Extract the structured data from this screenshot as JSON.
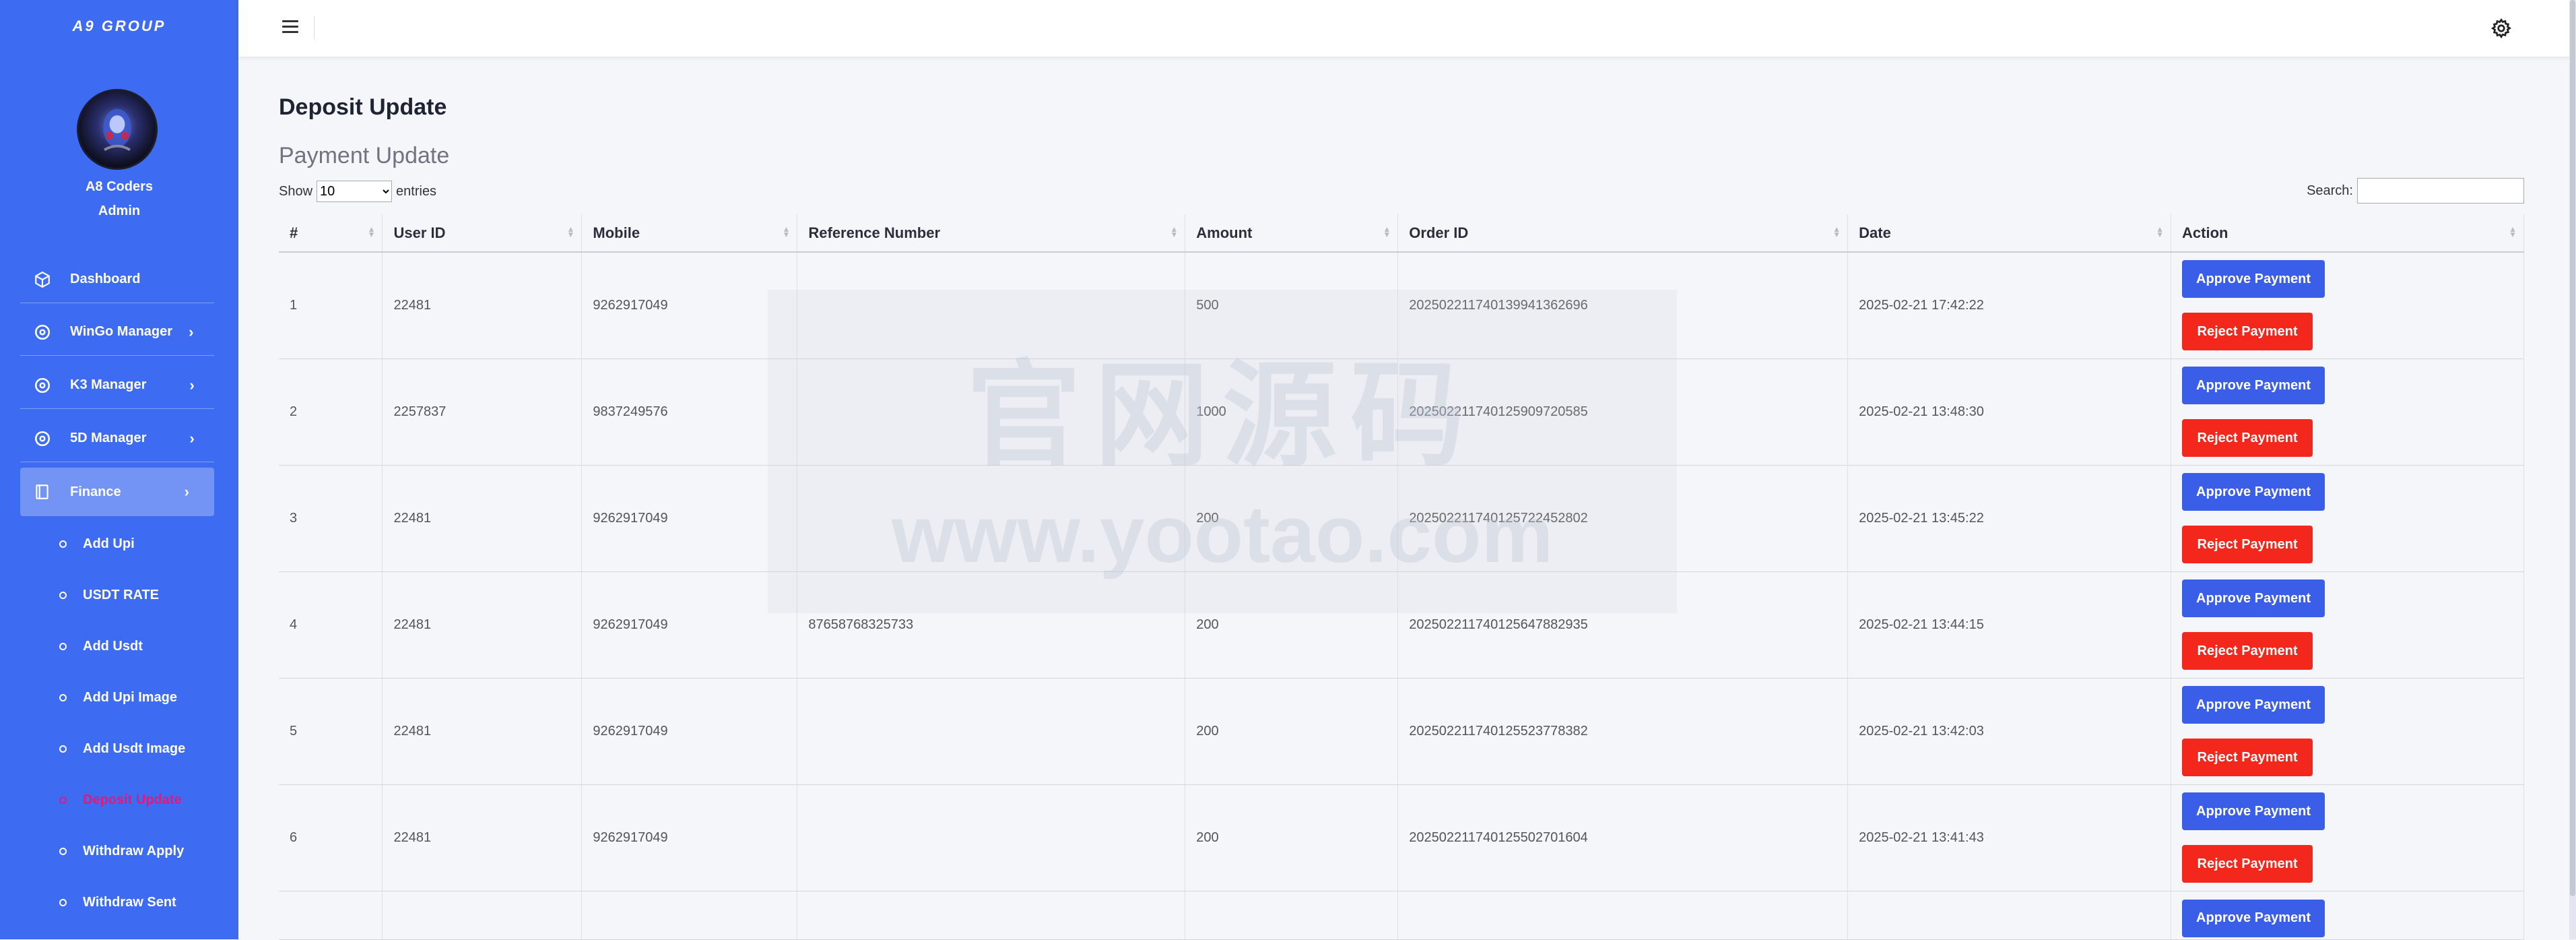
{
  "sidebar": {
    "brand": "A9 GROUP",
    "user_name": "A8 Coders",
    "user_role": "Admin",
    "nav": [
      {
        "label": "Dashboard",
        "icon": "cube-icon"
      },
      {
        "label": "WinGo Manager",
        "icon": "target-icon"
      },
      {
        "label": "K3 Manager",
        "icon": "target-icon"
      },
      {
        "label": "5D Manager",
        "icon": "target-icon"
      },
      {
        "label": "Finance",
        "icon": "book-icon"
      }
    ],
    "sub": [
      {
        "label": "Add Upi"
      },
      {
        "label": "USDT RATE"
      },
      {
        "label": "Add Usdt"
      },
      {
        "label": "Add Upi Image"
      },
      {
        "label": "Add Usdt Image"
      },
      {
        "label": "Deposit Update"
      },
      {
        "label": "Withdraw Apply"
      },
      {
        "label": "Withdraw Sent"
      }
    ]
  },
  "page": {
    "title": "Deposit Update",
    "section": "Payment Update",
    "show_prefix": "Show",
    "show_value": "10",
    "show_suffix": "entries",
    "search_label": "Search:"
  },
  "table": {
    "headers": [
      "#",
      "User ID",
      "Mobile",
      "Reference Number",
      "Amount",
      "Order ID",
      "Date",
      "Action"
    ],
    "approve_label": "Approve Payment",
    "reject_label": "Reject Payment",
    "rows": [
      {
        "n": "1",
        "user": "22481",
        "mobile": "9262917049",
        "ref": "",
        "amount": "500",
        "order": "20250221174013994136269​6",
        "date": "2025-02-21 17:42:22"
      },
      {
        "n": "2",
        "user": "2257837",
        "mobile": "9837249576",
        "ref": "",
        "amount": "1000",
        "order": "20250221174012590972058​5",
        "date": "2025-02-21 13:48:30"
      },
      {
        "n": "3",
        "user": "22481",
        "mobile": "9262917049",
        "ref": "",
        "amount": "200",
        "order": "20250221174012572245280​2",
        "date": "2025-02-21 13:45:22"
      },
      {
        "n": "4",
        "user": "22481",
        "mobile": "9262917049",
        "ref": "87658768325733",
        "amount": "200",
        "order": "20250221174012564788293​5",
        "date": "2025-02-21 13:44:15"
      },
      {
        "n": "5",
        "user": "22481",
        "mobile": "9262917049",
        "ref": "",
        "amount": "200",
        "order": "20250221174012552377838​2",
        "date": "2025-02-21 13:42:03"
      },
      {
        "n": "6",
        "user": "22481",
        "mobile": "9262917049",
        "ref": "",
        "amount": "200",
        "order": "20250221174012550270160​4",
        "date": "2025-02-21 13:41:43"
      }
    ]
  },
  "colors": {
    "sidebar": "#3d6bf2",
    "approve": "#3b5ee8",
    "reject": "#f3271b",
    "current_link": "#e01a7d"
  }
}
